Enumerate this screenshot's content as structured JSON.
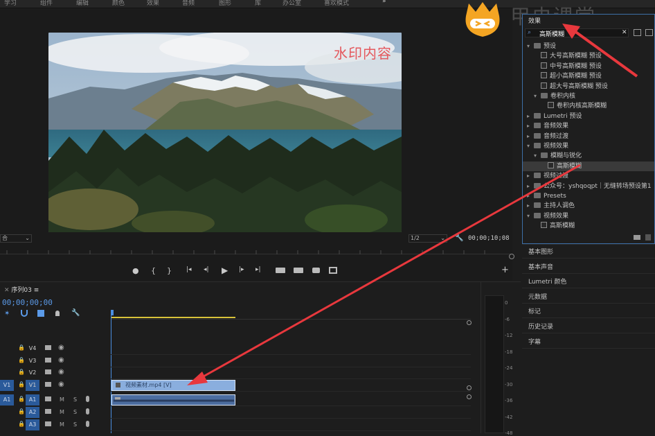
{
  "menu": [
    "学习",
    "组件",
    "编辑",
    "颜色",
    "效果",
    "音频",
    "图形",
    "库",
    "办公室",
    "喜欢模式"
  ],
  "menu_more": "»",
  "program_monitor": {
    "watermark": "水印内容",
    "fit_label": "合",
    "resolution": "1/2",
    "timecode": "00;00;10;08"
  },
  "transport": {
    "marker": "●",
    "in": "{",
    "out": "}",
    "goto_in": "|◂",
    "step_back": "◂|",
    "play": "▶",
    "step_fwd": "|▸",
    "goto_out": "▸|",
    "add": "+"
  },
  "logo_text": "甲虫课堂",
  "effects_panel": {
    "title": "效果",
    "search_value": "高斯模糊",
    "clear": "✕",
    "items": [
      {
        "indent": 0,
        "type": "folder",
        "open": true,
        "label": "预设"
      },
      {
        "indent": 1,
        "type": "fx",
        "label": "大号高斯模糊 预设"
      },
      {
        "indent": 1,
        "type": "fx",
        "label": "中号高斯模糊 预设"
      },
      {
        "indent": 1,
        "type": "fx",
        "label": "超小高斯模糊 预设"
      },
      {
        "indent": 1,
        "type": "fx",
        "label": "超大号高斯模糊 预设"
      },
      {
        "indent": 1,
        "type": "folder",
        "open": true,
        "label": "卷积内核"
      },
      {
        "indent": 2,
        "type": "fx",
        "label": "卷积内核高斯模糊"
      },
      {
        "indent": 0,
        "type": "folder",
        "open": false,
        "label": "Lumetri 预设"
      },
      {
        "indent": 0,
        "type": "folder",
        "open": false,
        "label": "音频效果"
      },
      {
        "indent": 0,
        "type": "folder",
        "open": false,
        "label": "音频过渡"
      },
      {
        "indent": 0,
        "type": "folder",
        "open": true,
        "label": "视频效果"
      },
      {
        "indent": 1,
        "type": "folder",
        "open": true,
        "label": "模糊与锐化"
      },
      {
        "indent": 2,
        "type": "fx",
        "label": "高斯模糊",
        "selected": true
      },
      {
        "indent": 0,
        "type": "folder",
        "open": false,
        "label": "视频过渡"
      },
      {
        "indent": 0,
        "type": "folder",
        "open": false,
        "label": "公众号：yshqoqpt｜无缝转场预设第1"
      },
      {
        "indent": 0,
        "type": "folder",
        "open": false,
        "label": "Presets"
      },
      {
        "indent": 0,
        "type": "folder",
        "open": false,
        "label": "主持人调色"
      },
      {
        "indent": 0,
        "type": "folder",
        "open": true,
        "label": "视频效果"
      },
      {
        "indent": 1,
        "type": "fx",
        "label": "高斯模糊"
      }
    ]
  },
  "side_panels": [
    "基本图形",
    "基本声音",
    "Lumetri 颜色",
    "元数据",
    "标记",
    "历史记录",
    "字幕"
  ],
  "sequence": {
    "tab": "序列03",
    "menu": "≡",
    "timecode": "00;00;00;00",
    "tracks_video": [
      {
        "name": "V4",
        "src": ""
      },
      {
        "name": "V3",
        "src": ""
      },
      {
        "name": "V2",
        "src": ""
      },
      {
        "name": "V1",
        "src": "V1"
      }
    ],
    "tracks_audio": [
      {
        "name": "A1",
        "src": "A1"
      },
      {
        "name": "A2",
        "src": ""
      },
      {
        "name": "A3",
        "src": ""
      }
    ],
    "clip_video": "视频素材.mp4 [V]",
    "m_label": "M",
    "s_label": "S"
  },
  "meter_labels": [
    "0",
    "-6",
    "-12",
    "-18",
    "-24",
    "-30",
    "-36",
    "-42",
    "-48"
  ],
  "colors": {
    "accent_blue": "#2a5a9a",
    "clip_blue": "#8aaede",
    "arrow_red": "#e8383d",
    "work_area_yellow": "#d8c23a",
    "watermark_red": "#e4585d"
  }
}
